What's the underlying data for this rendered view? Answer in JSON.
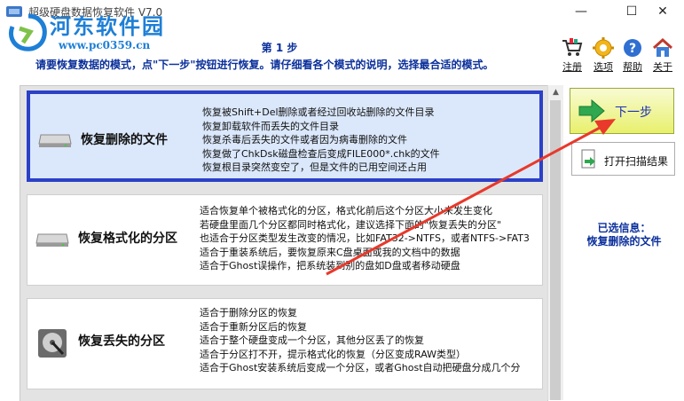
{
  "window": {
    "title": "超级硬盘数据恢复软件 V7.0",
    "minimize": "—",
    "maximize": "☐",
    "close": "✕"
  },
  "watermark": {
    "name": "河东软件园",
    "url": "www.pc0359.cn"
  },
  "header": {
    "step": "第 1 步",
    "instruction": "请要恢复数据的模式，点\"下一步\"按钮进行恢复。请仔细看各个模式的说明，选择最合适的模式。"
  },
  "toolbar": [
    {
      "label": "注册",
      "icon": "cart-icon"
    },
    {
      "label": "选项",
      "icon": "gear-icon"
    },
    {
      "label": "帮助",
      "icon": "help-icon"
    },
    {
      "label": "关于",
      "icon": "house-icon"
    }
  ],
  "modes": [
    {
      "title": "恢复删除的文件",
      "selected": true,
      "icon": "drive-icon",
      "desc": [
        "恢复被Shift+Del删除或者经过回收站删除的文件目录",
        "恢复卸载软件而丢失的文件目录",
        "恢复杀毒后丢失的文件或者因为病毒删除的文件",
        "恢复做了ChkDsk磁盘检查后变成FILE000*.chk的文件",
        "恢复根目录突然变空了，但是文件的已用空间还占用"
      ]
    },
    {
      "title": "恢复格式化的分区",
      "selected": false,
      "icon": "drive-icon",
      "desc": [
        "适合恢复单个被格式化的分区，格式化前后这个分区大小未发生变化",
        "若硬盘里面几个分区都同时格式化，建议选择下面的\"恢复丢失的分区\"",
        "也适合于分区类型发生改变的情况，比如FAT32->NTFS，或者NTFS->FAT3",
        "适合于重装系统后，要恢复原来C盘桌面或我的文档中的数据",
        "适合于Ghost误操作，把系统装到别的盘如D盘或者移动硬盘"
      ]
    },
    {
      "title": "恢复丢失的分区",
      "selected": false,
      "icon": "harddisk-icon",
      "desc": [
        "适合于删除分区的恢复",
        "适合于重新分区后的恢复",
        "适合于整个硬盘变成一个分区，其他分区丢了的恢复",
        "适合于分区打不开，提示格式化的恢复（分区变成RAW类型）",
        "适合于Ghost安装系统后变成一个分区，或者Ghost自动把硬盘分成几个分"
      ]
    }
  ],
  "actions": {
    "next": "下一步",
    "open_scan": "打开扫描结果"
  },
  "selected_info": {
    "label": "已选信息：",
    "value": "恢复删除的文件"
  },
  "colors": {
    "accent": "#2c40c8",
    "text_blue": "#0a2f9b",
    "arrow": "#e8392b"
  }
}
